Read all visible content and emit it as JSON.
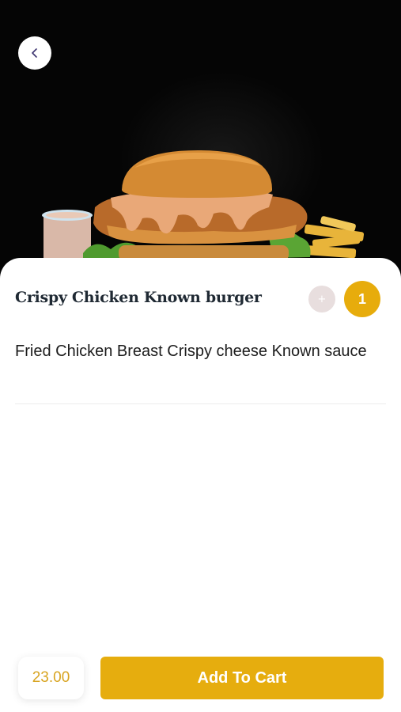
{
  "header": {
    "back_icon": "chevron-left-icon"
  },
  "product": {
    "title": "Crispy Chicken Known burger",
    "description": "Fried Chicken Breast Crispy cheese Known sauce",
    "image": "burger-photo"
  },
  "quantity": {
    "plus_label": "+",
    "value": "1"
  },
  "footer": {
    "price": "23.00",
    "add_to_cart_label": "Add To Cart"
  },
  "colors": {
    "accent": "#e6ad0e",
    "price_text": "#d8a420",
    "plus_bg": "#e8dede",
    "hero_bg": "#050505"
  }
}
